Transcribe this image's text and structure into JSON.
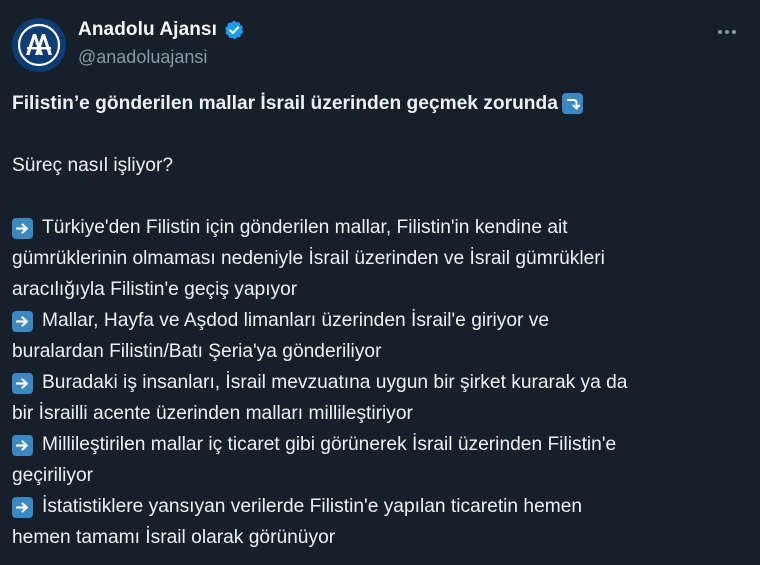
{
  "account": {
    "display_name": "Anadolu Ajansı",
    "handle": "@anadoluajansi",
    "avatar_text": "AA",
    "verified": true
  },
  "tweet": {
    "headline": "Filistin’e gönderilen mallar İsrail üzerinden geçmek zorunda",
    "headline_emoji": "arrow-right-hook-down-icon",
    "question": "Süreç nasıl işliyor?",
    "bullet_emoji": "arrow-right-icon",
    "bullets": [
      {
        "lines": [
          "Türkiye'den Filistin için gönderilen mallar, Filistin'in kendine ait",
          "gümrüklerinin olmaması nedeniyle İsrail üzerinden ve İsrail gümrükleri",
          "aracılığıyla Filistin'e geçiş yapıyor"
        ]
      },
      {
        "lines": [
          "Mallar, Hayfa ve Aşdod limanları üzerinden İsrail'e giriyor ve",
          "buralardan Filistin/Batı Şeria'ya gönderiliyor"
        ]
      },
      {
        "lines": [
          "Buradaki iş insanları, İsrail mevzuatına uygun bir şirket kurarak ya da",
          "bir İsrailli acente üzerinden malları millileştiriyor"
        ]
      },
      {
        "lines": [
          "Millileştirilen mallar iç ticaret gibi görünerek İsrail üzerinden Filistin'e",
          "geçiriliyor"
        ]
      },
      {
        "lines": [
          "İstatistiklere yansıyan verilerde Filistin'e yapılan ticaretin hemen",
          "hemen tamamı İsrail olarak görünüyor"
        ]
      }
    ]
  },
  "colors": {
    "background": "#15202b",
    "text": "#eef1f3",
    "secondary_text": "#8b98a5",
    "verified_badge": "#1d9bf0",
    "emoji_box": "#3b88c3",
    "avatar_bg": "#0d3b73"
  }
}
